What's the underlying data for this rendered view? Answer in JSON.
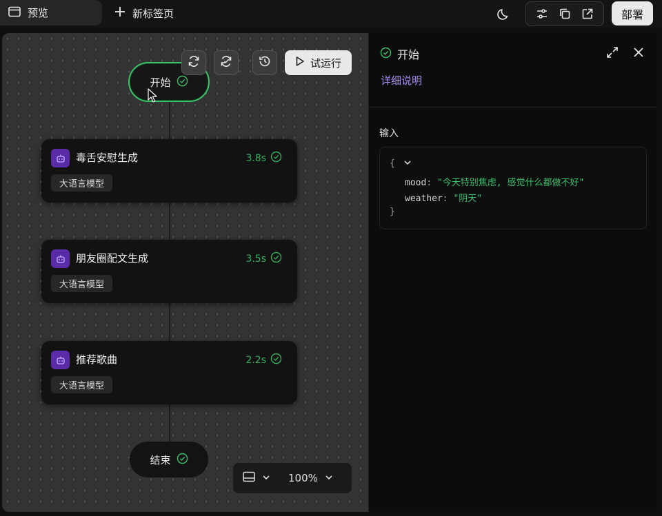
{
  "tabs": {
    "preview_label": "预览",
    "new_tab_label": "新标签页"
  },
  "header": {
    "deploy_label": "部署"
  },
  "canvas": {
    "trial_run_label": "试运行",
    "start_node": {
      "label": "开始"
    },
    "end_node": {
      "label": "结束"
    },
    "nodes": [
      {
        "title": "毒舌安慰生成",
        "time": "3.8s",
        "tag": "大语言模型"
      },
      {
        "title": "朋友圈配文生成",
        "time": "3.5s",
        "tag": "大语言模型"
      },
      {
        "title": "推荐歌曲",
        "time": "2.2s",
        "tag": "大语言模型"
      }
    ],
    "zoom_level": "100%"
  },
  "panel": {
    "title": "开始",
    "detail_link": "详细说明",
    "input_label": "输入",
    "code": {
      "open_brace": "{",
      "close_brace": "}",
      "fields": [
        {
          "key": "mood",
          "value": "\"今天特别焦虑, 感觉什么都做不好\""
        },
        {
          "key": "weather",
          "value": "\"阴天\""
        }
      ]
    }
  },
  "colors": {
    "success": "#3cc26a",
    "accent_link": "#a58df0",
    "bot_icon_bg": "#5a2ba8"
  }
}
